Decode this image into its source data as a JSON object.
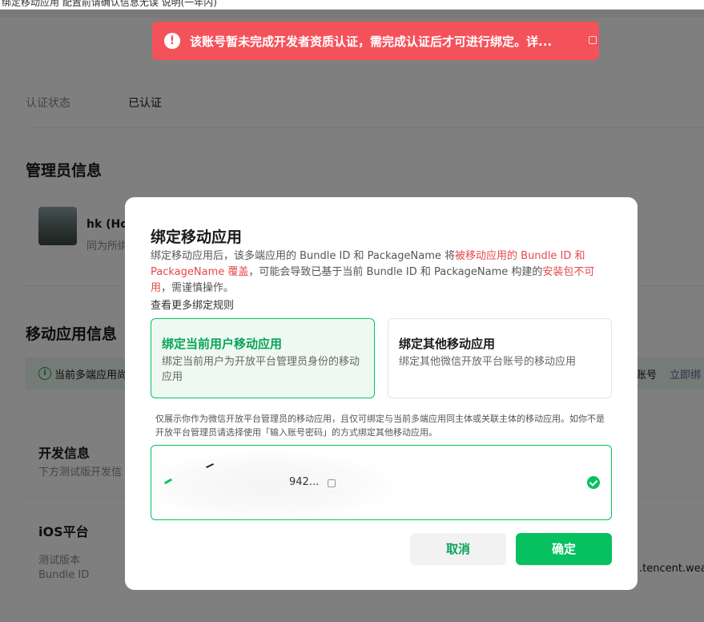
{
  "browser_top_text": "绑定移动应用 配置前请确认信息无误 说明(一年内)",
  "background": {
    "auth_status_label": "认证状态",
    "auth_status_value": "已认证",
    "admin_section_title": "管理员信息",
    "admin_name": "hk (Ho*",
    "admin_sub": "同为所绑",
    "mobile_section_title": "移动应用信息",
    "notice_text": "当前多端应用尚",
    "notice_right_text": "账号",
    "notice_link": "立即绑",
    "dev_info_title": "开发信息",
    "dev_info_sub": "下方测试版开发信",
    "ios_title": "iOS平台",
    "ios_test_version_label": "测试版本",
    "ios_bundle_id_label": "Bundle ID",
    "ios_bundle_value": ".tencent.weau"
  },
  "toast": {
    "icon": "exclamation-icon",
    "text": "该账号暂未完成开发者资质认证，需完成认证后才可进行绑定。详..."
  },
  "dialog": {
    "title": "绑定移动应用",
    "desc_part1": "绑定移动应用后，该多端应用的 Bundle ID 和 PackageName 将",
    "desc_red1": "被移动应用的 Bundle ID 和 PackageName 覆盖",
    "desc_part2": "，可能会导致已基于当前 Bundle ID 和 PackageName 构建的",
    "desc_red2": "安装包不可用",
    "desc_part3": "，需谨慎操作。",
    "rules_link": "查看更多绑定规则",
    "option_current": {
      "title": "绑定当前用户移动应用",
      "desc": "绑定当前用户为开放平台管理员身份的移动应用"
    },
    "option_other": {
      "title": "绑定其他移动应用",
      "desc": "绑定其他微信开放平台账号的移动应用"
    },
    "hint": "仅展示你作为微信开放平台管理员的移动应用，且仅可绑定与当前多端应用同主体或关联主体的移动应用。如你不是开放平台管理员请选择使用「输入账号密码」的方式绑定其他移动应用。",
    "app_id_partial": "942...",
    "cancel_label": "取消",
    "confirm_label": "确定"
  },
  "colors": {
    "accent": "#07c160",
    "accent_text": "#07a35a",
    "toast_bg": "#f4525b",
    "warning_text": "#e5484d"
  }
}
